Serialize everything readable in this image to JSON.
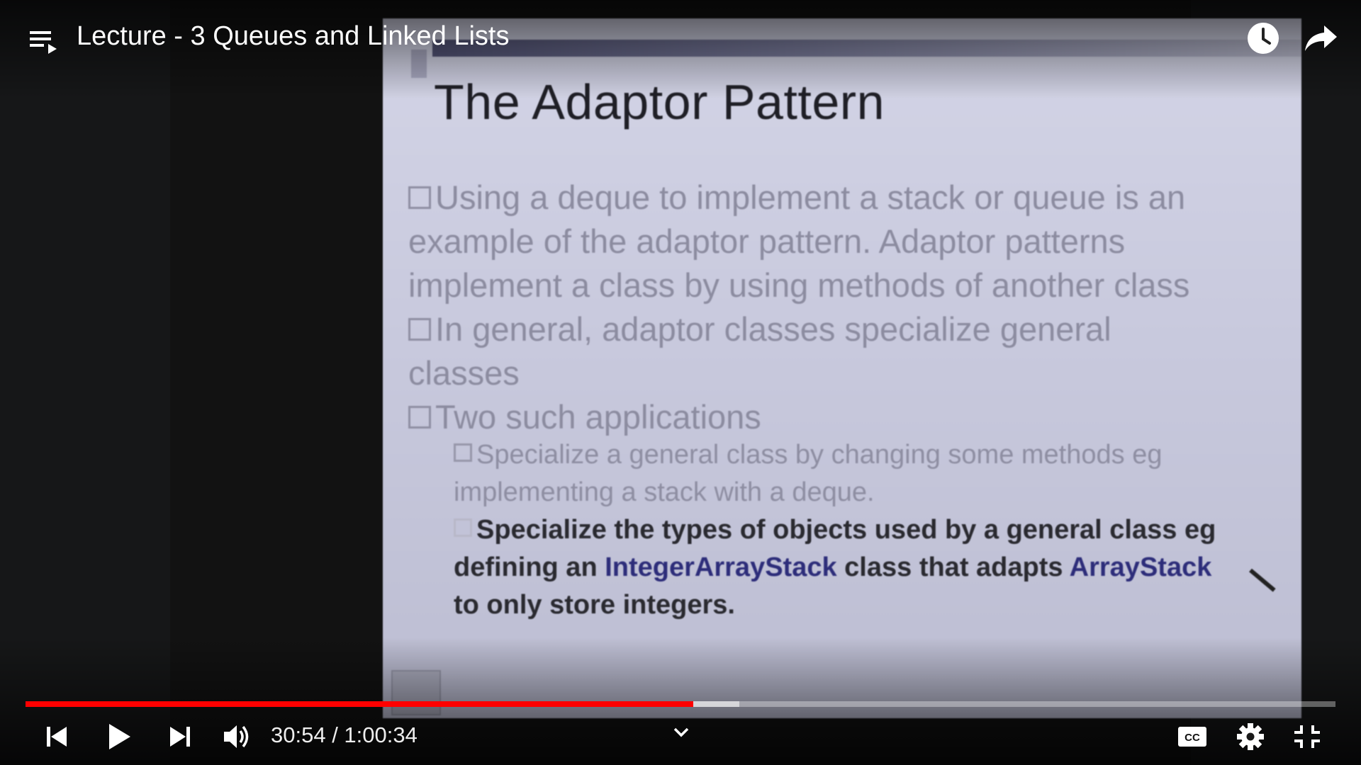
{
  "header": {
    "title": "Lecture - 3 Queues and Linked Lists",
    "icons": {
      "playlist": "playlist-icon",
      "watch_later": "clock-icon",
      "share": "share-icon"
    }
  },
  "slide": {
    "title": "The Adaptor Pattern",
    "bullet1_line1": "Using a deque to implement a stack or queue is an",
    "bullet1_line2": "example of the adaptor pattern. Adaptor patterns",
    "bullet1_line3": "implement a class by using methods of another class",
    "bullet2_line1": "In general, adaptor classes specialize general",
    "bullet2_line2": "classes",
    "bullet3": "Two such applications",
    "sub1_line1": "Specialize a general class by changing some methods eg",
    "sub1_line2": "implementing a stack with a deque.",
    "sub2_line1": "Specialize the types of objects used by a general class eg",
    "sub2_line2_a": "defining an ",
    "sub2_line2_b": "IntegerArrayStack",
    "sub2_line2_c": " class that adapts ",
    "sub2_line2_d": "ArrayStack",
    "sub2_line3": "to only store integers."
  },
  "player": {
    "current_time": "30:54",
    "separator": " / ",
    "duration": "1:00:34",
    "progress_fraction": 0.51,
    "buffered_fraction": 0.545,
    "colors": {
      "played": "#ff0000",
      "text": "#ffffff"
    },
    "icons": {
      "previous": "previous-icon",
      "play": "play-icon",
      "next": "next-icon",
      "volume": "volume-icon",
      "chevron": "chevron-down-icon",
      "captions": "cc-icon",
      "settings": "gear-icon",
      "exit_fullscreen": "exit-fullscreen-icon"
    }
  }
}
